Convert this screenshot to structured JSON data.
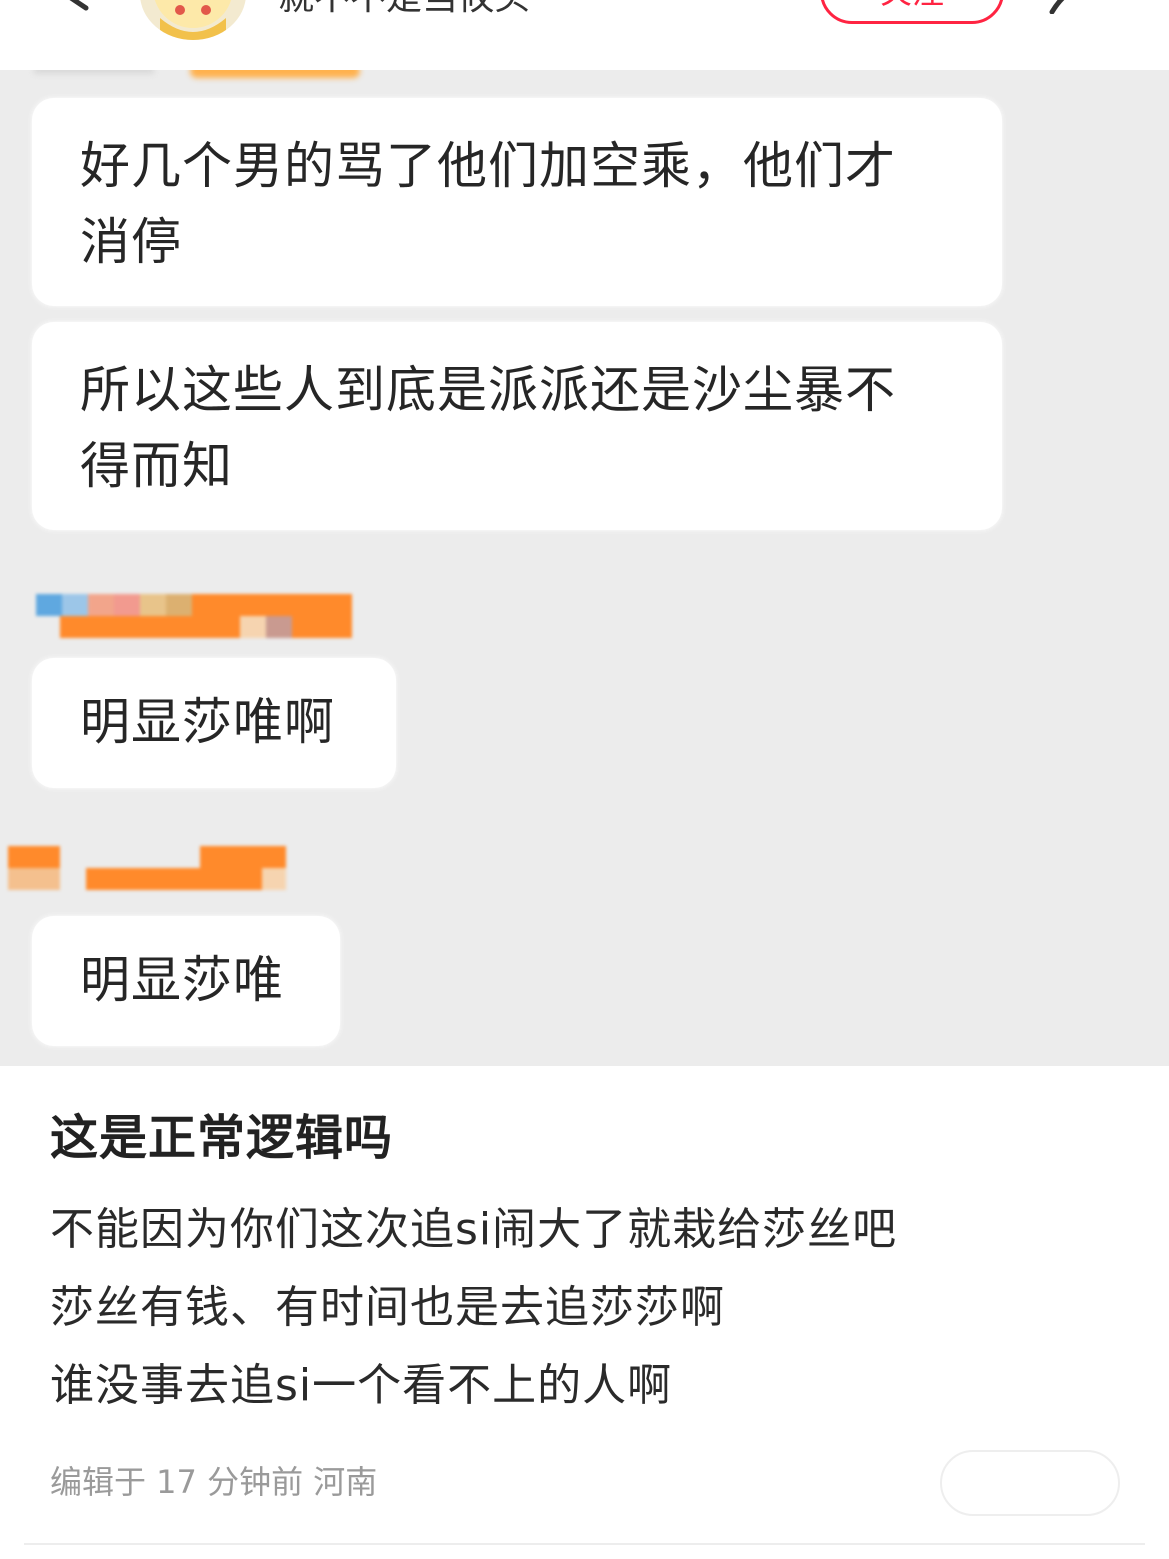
{
  "header": {
    "author_name": "就不不是当攸头",
    "follow_label": "关注",
    "avatar_color": "#f3ead0",
    "accent_color": "#ff2442"
  },
  "screenshot": {
    "background": "#ececec",
    "messages": [
      {
        "lines": [
          "好几个男的骂了他们加空乘，他们才",
          "消停"
        ]
      },
      {
        "lines": [
          "所以这些人到底是派派还是沙尘暴不",
          "得而知"
        ]
      },
      {
        "lines": [
          "明显莎唯啊"
        ]
      },
      {
        "lines": [
          "明显莎唯"
        ]
      }
    ],
    "redaction_color": "#ff8a2b"
  },
  "post": {
    "title": "这是正常逻辑吗",
    "body": [
      "不能因为你们这次追si闹大了就栽给莎丝吧",
      "莎丝有钱、有时间也是去追莎莎啊",
      "谁没事去追si一个看不上的人啊"
    ],
    "meta": "编辑于 17 分钟前 河南"
  }
}
